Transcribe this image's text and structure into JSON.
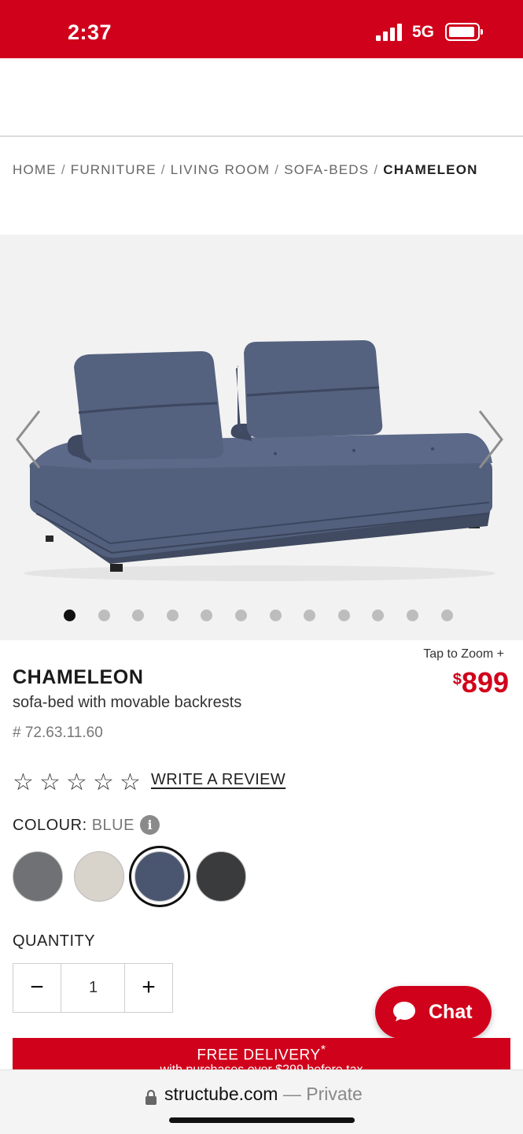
{
  "status_bar": {
    "time": "2:37",
    "network": "5G"
  },
  "breadcrumb": {
    "items": [
      "HOME",
      "FURNITURE",
      "LIVING ROOM",
      "SOFA-BEDS"
    ],
    "separator": "/",
    "current": "CHAMELEON"
  },
  "gallery": {
    "image_count": 12,
    "active_index": 0,
    "prev_icon": "chevron-left-icon",
    "next_icon": "chevron-right-icon"
  },
  "product": {
    "zoom_hint": "Tap to Zoom",
    "zoom_icon": "+",
    "price_currency": "$",
    "price_amount": "899",
    "name": "CHAMELEON",
    "description": "sofa-bed with movable backrests",
    "sku": "# 72.63.11.60"
  },
  "rating": {
    "stars": 0,
    "max_stars": 5,
    "write_review_label": "WRITE A REVIEW"
  },
  "colour": {
    "label": "COLOUR:",
    "selected": "BLUE",
    "info_icon": "i",
    "swatches": [
      {
        "name": "grey",
        "color": "#6f7175"
      },
      {
        "name": "beige",
        "color": "#d8d3cb"
      },
      {
        "name": "blue",
        "color": "#4a5670",
        "selected": true
      },
      {
        "name": "charcoal",
        "color": "#3a3b3d"
      }
    ]
  },
  "quantity": {
    "label": "QUANTITY",
    "minus": "−",
    "value": "1",
    "plus": "+"
  },
  "chat": {
    "label": "Chat"
  },
  "promo": {
    "title": "FREE DELIVERY",
    "title_mark": "*",
    "subtitle": "with purchases over $299 before tax"
  },
  "address_bar": {
    "domain": "structube.com",
    "suffix": " — Private"
  },
  "colors": {
    "brand_red": "#d0021b",
    "sofa_blue": "#4a5670"
  }
}
